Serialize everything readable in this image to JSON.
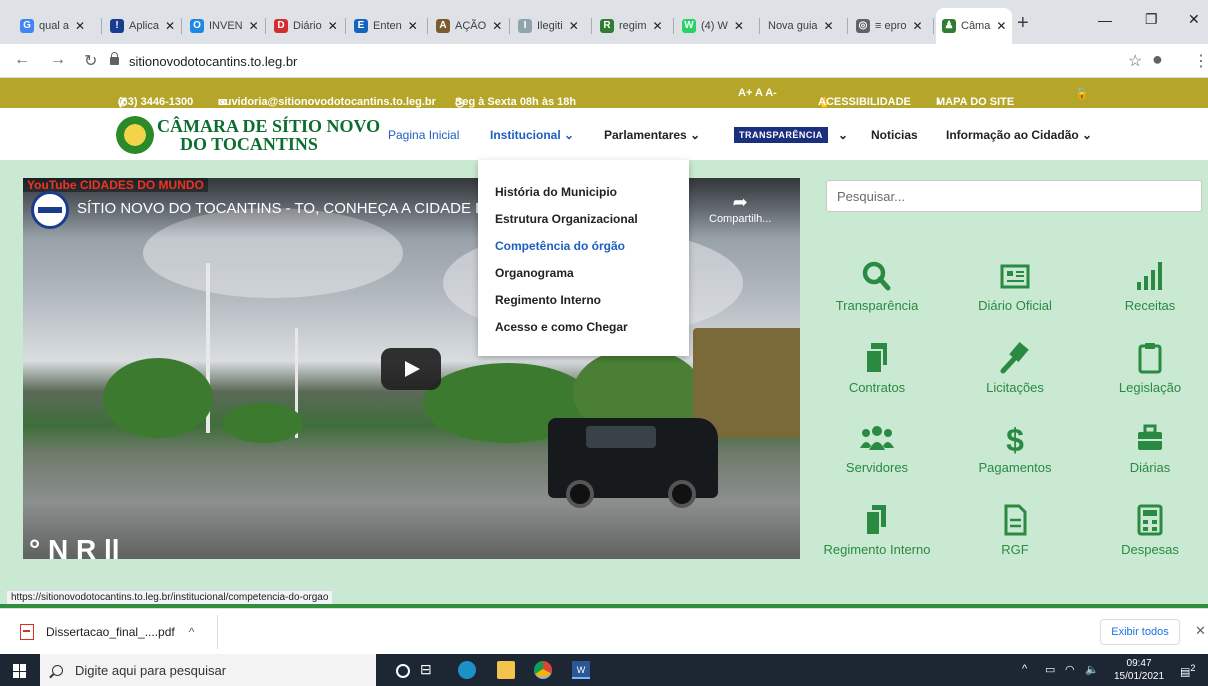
{
  "browser": {
    "tabs": [
      {
        "label": "qual a",
        "fav_color": "#4285f4",
        "fav_text": "G"
      },
      {
        "label": "Aplica",
        "fav_color": "#1a3c8f",
        "fav_text": "!!"
      },
      {
        "label": "INVEN",
        "fav_color": "#1e88e5",
        "fav_text": "O"
      },
      {
        "label": "Diário",
        "fav_color": "#d32f2f",
        "fav_text": "D"
      },
      {
        "label": "Enten",
        "fav_color": "#1565c0",
        "fav_text": "E"
      },
      {
        "label": "AÇÃO",
        "fav_color": "#7a5c2e",
        "fav_text": "A"
      },
      {
        "label": "Ilegiti",
        "fav_color": "#90a4ae",
        "fav_text": "I"
      },
      {
        "label": "regim",
        "fav_color": "#2e7d32",
        "fav_text": "R"
      },
      {
        "label": "(4) W",
        "fav_color": "#25d366",
        "fav_text": "W"
      },
      {
        "label": "Nova guia",
        "fav_color": "",
        "fav_text": ""
      },
      {
        "label": "≡ epro",
        "fav_color": "#5f6368",
        "fav_text": "◎"
      },
      {
        "label": "Câma",
        "fav_color": "#2e7d32",
        "fav_text": "♟"
      }
    ],
    "url": "sitionovodotocantins.to.leg.br",
    "status_url": "https://sitionovodotocantins.to.leg.br/institucional/competencia-do-orgao"
  },
  "topbar": {
    "phone": "(63) 3446-1300",
    "email": "ouvidoria@sitionovodotocantins.to.leg.br",
    "hours": "Seg à Sexta 08h às 18h",
    "font_controls": "A+  A  A-",
    "accessibility": "ACESSIBILIDADE",
    "sitemap": "MAPA DO SITE"
  },
  "header": {
    "logo_line1": "CÂMARA DE SÍTIO NOVO",
    "logo_line2": "DO TOCANTINS",
    "nav": {
      "home": "Pagina Inicial",
      "institucional": "Institucional",
      "parlamentares": "Parlamentares",
      "transparencia": "TRANSPARÊNCIA",
      "noticias": "Noticias",
      "informacao": "Informação ao Cidadão"
    }
  },
  "dropdown": {
    "items": [
      "História do Municipio",
      "Estrutura Organizacional",
      "Competência do órgão",
      "Organograma",
      "Regimento Interno",
      "Acesso e como Chegar"
    ]
  },
  "video": {
    "channel_banner": "YouTube CIDADES DO MUNDO",
    "title": "SÍTIO NOVO DO TOCANTINS - TO, CONHEÇA A CIDADE D",
    "share": "Compartilh...",
    "bottom_text": "° N  R  ll"
  },
  "sidebar": {
    "search_placeholder": "Pesquisar...",
    "links": [
      {
        "label": "Transparência",
        "icon": "search-icon"
      },
      {
        "label": "Diário Oficial",
        "icon": "newspaper-icon"
      },
      {
        "label": "Receitas",
        "icon": "signal-bars-icon"
      },
      {
        "label": "Contratos",
        "icon": "copy-icon"
      },
      {
        "label": "Licitações",
        "icon": "gavel-icon"
      },
      {
        "label": "Legislação",
        "icon": "clipboard-icon"
      },
      {
        "label": "Servidores",
        "icon": "users-icon"
      },
      {
        "label": "Pagamentos",
        "icon": "dollar-icon"
      },
      {
        "label": "Diárias",
        "icon": "briefcase-icon"
      },
      {
        "label": "Regimento Interno",
        "icon": "files-icon"
      },
      {
        "label": "RGF",
        "icon": "file-text-icon"
      },
      {
        "label": "Despesas",
        "icon": "calculator-icon"
      }
    ],
    "accent": "#2a8a42"
  },
  "downloads": {
    "file": "Dissertacao_final_....pdf",
    "show_all": "Exibir todos"
  },
  "taskbar": {
    "search_placeholder": "Digite aqui para pesquisar",
    "time": "09:47",
    "date": "15/01/2021",
    "notifications": "2"
  }
}
